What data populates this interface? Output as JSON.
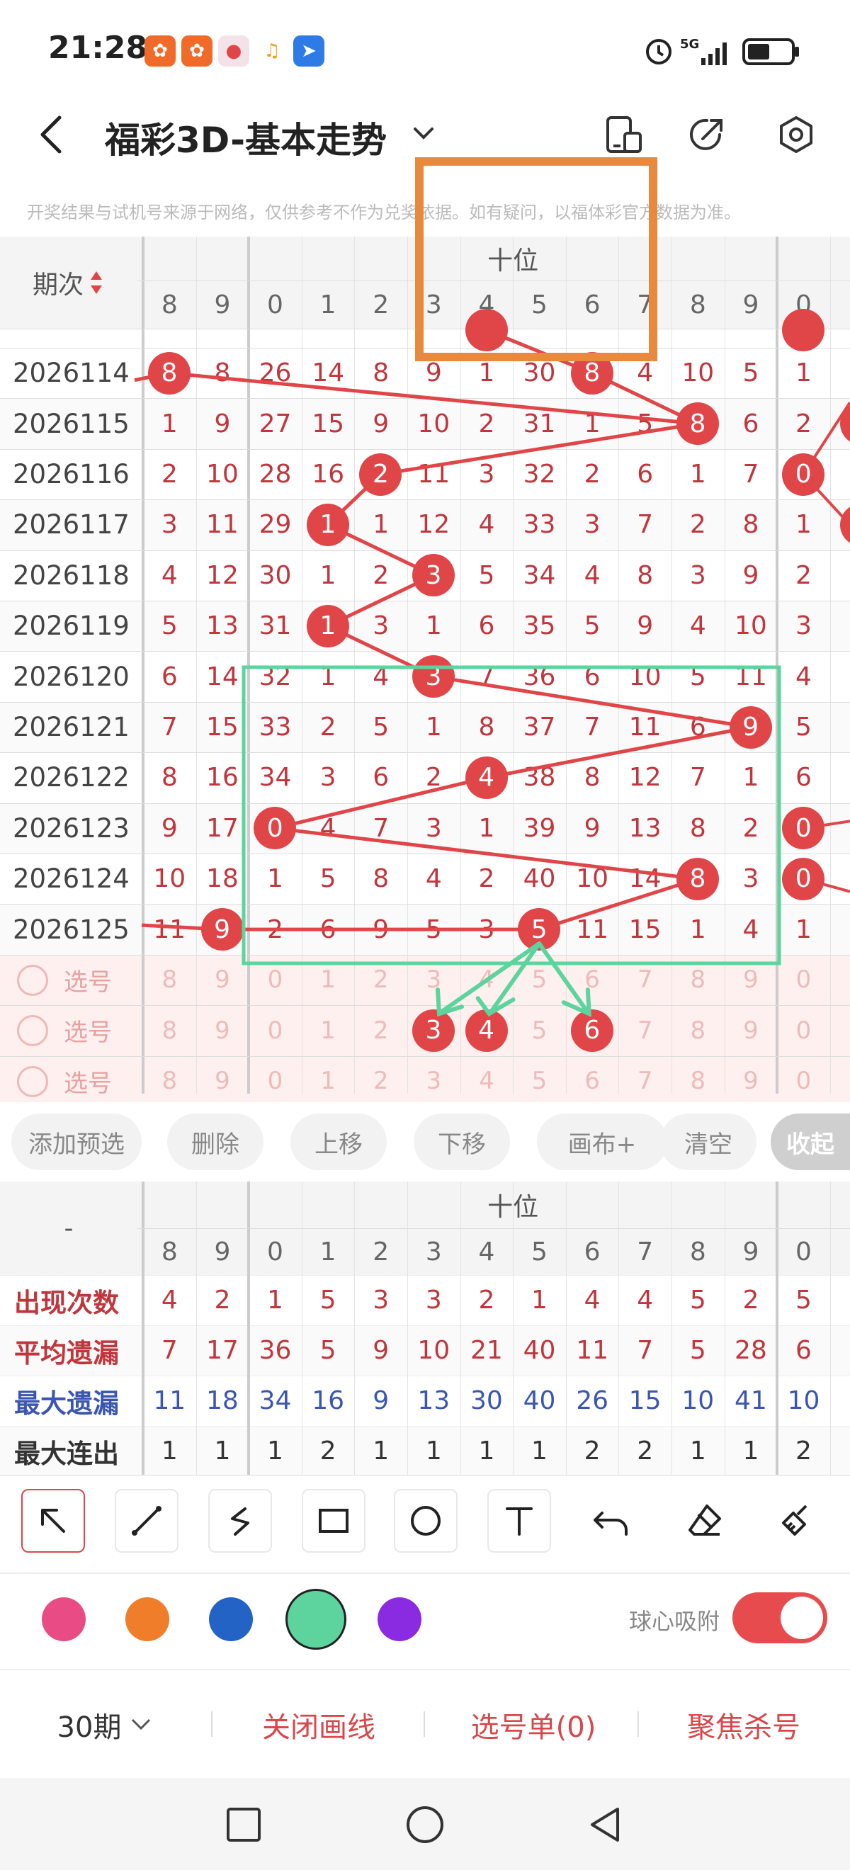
{
  "status": {
    "time": "21:28",
    "network": "5G"
  },
  "header": {
    "title": "福彩3D-基本走势",
    "disclaimer": "开奖结果与试机号来源于网络，仅供参考不作为兑奖依据。如有疑问，以福体彩官方数据为准。"
  },
  "table": {
    "period_header": "期次",
    "group_header": "十位",
    "col_digits": [
      "8",
      "9",
      "0",
      "1",
      "2",
      "3",
      "4",
      "5",
      "6",
      "7",
      "8",
      "9",
      "0"
    ],
    "rows": [
      {
        "period": "2026114",
        "cells": [
          "8",
          "8",
          "26",
          "14",
          "8",
          "9",
          "1",
          "30",
          "8",
          "4",
          "10",
          "5",
          "1"
        ]
      },
      {
        "period": "2026115",
        "cells": [
          "1",
          "9",
          "27",
          "15",
          "9",
          "10",
          "2",
          "31",
          "1",
          "5",
          "8",
          "6",
          "2"
        ]
      },
      {
        "period": "2026116",
        "cells": [
          "2",
          "10",
          "28",
          "16",
          "2",
          "11",
          "3",
          "32",
          "2",
          "6",
          "1",
          "7",
          "0"
        ]
      },
      {
        "period": "2026117",
        "cells": [
          "3",
          "11",
          "29",
          "1",
          "1",
          "12",
          "4",
          "33",
          "3",
          "7",
          "2",
          "8",
          "1"
        ]
      },
      {
        "period": "2026118",
        "cells": [
          "4",
          "12",
          "30",
          "1",
          "2",
          "3",
          "5",
          "34",
          "4",
          "8",
          "3",
          "9",
          "2"
        ]
      },
      {
        "period": "2026119",
        "cells": [
          "5",
          "13",
          "31",
          "1",
          "3",
          "1",
          "6",
          "35",
          "5",
          "9",
          "4",
          "10",
          "3"
        ]
      },
      {
        "period": "2026120",
        "cells": [
          "6",
          "14",
          "32",
          "1",
          "4",
          "3",
          "7",
          "36",
          "6",
          "10",
          "5",
          "11",
          "4"
        ]
      },
      {
        "period": "2026121",
        "cells": [
          "7",
          "15",
          "33",
          "2",
          "5",
          "1",
          "8",
          "37",
          "7",
          "11",
          "6",
          "9",
          "5"
        ]
      },
      {
        "period": "2026122",
        "cells": [
          "8",
          "16",
          "34",
          "3",
          "6",
          "2",
          "4",
          "38",
          "8",
          "12",
          "7",
          "1",
          "6"
        ]
      },
      {
        "period": "2026123",
        "cells": [
          "9",
          "17",
          "0",
          "4",
          "7",
          "3",
          "1",
          "39",
          "9",
          "13",
          "8",
          "2",
          "0"
        ]
      },
      {
        "period": "2026124",
        "cells": [
          "10",
          "18",
          "1",
          "5",
          "8",
          "4",
          "2",
          "40",
          "10",
          "14",
          "8",
          "3",
          "0"
        ]
      },
      {
        "period": "2026125",
        "cells": [
          "11",
          "9",
          "2",
          "6",
          "9",
          "5",
          "3",
          "5",
          "11",
          "15",
          "1",
          "4",
          "1"
        ]
      }
    ],
    "select_label": "选号",
    "select_rows": [
      {
        "cells": [
          "8",
          "9",
          "0",
          "1",
          "2",
          "3",
          "4",
          "5",
          "6",
          "7",
          "8",
          "9",
          "0"
        ]
      },
      {
        "cells": [
          "8",
          "9",
          "0",
          "1",
          "2",
          "3",
          "4",
          "5",
          "6",
          "7",
          "8",
          "9",
          "0"
        ]
      },
      {
        "cells": [
          "8",
          "9",
          "0",
          "1",
          "2",
          "3",
          "4",
          "5",
          "6",
          "7",
          "8",
          "9",
          "0"
        ]
      }
    ]
  },
  "actions": [
    "添加预选",
    "删除",
    "上移",
    "下移",
    "画布+",
    "清空",
    "收起"
  ],
  "stats": {
    "dash": "-",
    "group_header": "十位",
    "col_digits": [
      "8",
      "9",
      "0",
      "1",
      "2",
      "3",
      "4",
      "5",
      "6",
      "7",
      "8",
      "9",
      "0"
    ],
    "rows": [
      {
        "label": "出现次数",
        "color": "#c0363c",
        "cells": [
          "4",
          "2",
          "1",
          "5",
          "3",
          "3",
          "2",
          "1",
          "4",
          "4",
          "5",
          "2",
          "5"
        ]
      },
      {
        "label": "平均遗漏",
        "color": "#c0363c",
        "cells": [
          "7",
          "17",
          "36",
          "5",
          "9",
          "10",
          "21",
          "40",
          "11",
          "7",
          "5",
          "28",
          "6"
        ]
      },
      {
        "label": "最大遗漏",
        "color": "#3a56b0",
        "cells": [
          "11",
          "18",
          "34",
          "16",
          "9",
          "13",
          "30",
          "40",
          "26",
          "15",
          "10",
          "41",
          "10"
        ]
      },
      {
        "label": "最大连出",
        "color": "#333",
        "cells": [
          "1",
          "1",
          "1",
          "2",
          "1",
          "1",
          "1",
          "1",
          "2",
          "2",
          "1",
          "1",
          "2"
        ]
      }
    ]
  },
  "palette": {
    "colors": [
      "#e94c84",
      "#f07d2a",
      "#2463c6",
      "#5dd39e",
      "#8a2be2"
    ],
    "selected": "#5dd39e",
    "snap_label": "球心吸附",
    "snap_on": true
  },
  "bottom": {
    "period_select": "30期",
    "close_draw": "关闭画线",
    "select_list": "选号单(0)",
    "focus_kill": "聚焦杀号"
  }
}
